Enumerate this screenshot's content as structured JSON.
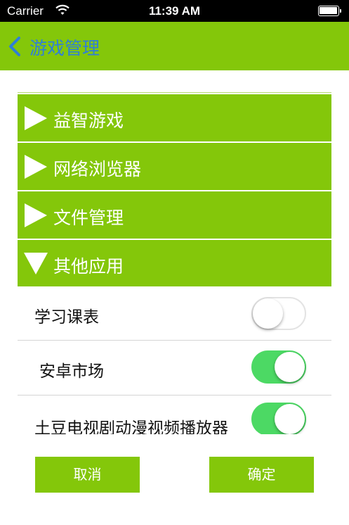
{
  "status_bar": {
    "carrier": "Carrier",
    "time": "11:39 AM"
  },
  "nav_bar": {
    "title": "游戏管理"
  },
  "groups": [
    {
      "label": "益智游戏",
      "expanded": false
    },
    {
      "label": "网络浏览器",
      "expanded": false
    },
    {
      "label": "文件管理",
      "expanded": false
    },
    {
      "label": "其他应用",
      "expanded": true
    }
  ],
  "children": [
    {
      "label": "学习课表",
      "enabled": false
    },
    {
      "label": "安卓市场",
      "enabled": true
    },
    {
      "label": "土豆电视剧动漫视频播放器",
      "enabled": true
    }
  ],
  "buttons": {
    "cancel": "取消",
    "confirm": "确定"
  },
  "colors": {
    "accent_green": "#84c70a",
    "switch_on": "#4cd964",
    "back_blue": "#2f7fd8"
  }
}
